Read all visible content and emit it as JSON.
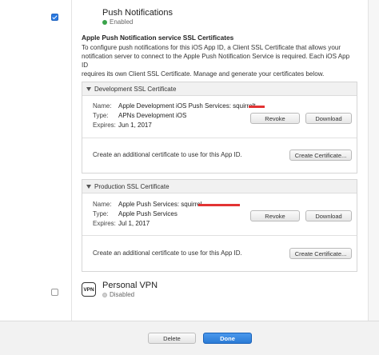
{
  "push": {
    "checked": true,
    "title": "Push Notifications",
    "status": "Enabled",
    "status_color": "#3aa34a",
    "description_title": "Apple Push Notification service SSL Certificates",
    "description_lines": [
      "To configure push notifications for this iOS App ID, a Client SSL Certificate that allows your",
      "notification server to connect to the Apple Push Notification Service is required. Each iOS App ID",
      "requires its own Client SSL Certificate. Manage and generate your certificates below."
    ]
  },
  "development": {
    "header": "Development SSL Certificate",
    "name_label": "Name:",
    "name_value": "Apple Development iOS Push Services: squirrelt",
    "type_label": "Type:",
    "type_value": "APNs Development iOS",
    "expires_label": "Expires:",
    "expires_value": "Jun 1, 2017",
    "revoke_label": "Revoke",
    "download_label": "Download",
    "create_text": "Create an additional certificate to use for this App ID.",
    "create_button": "Create Certificate..."
  },
  "production": {
    "header": "Production SSL Certificate",
    "name_label": "Name:",
    "name_value": "Apple Push Services: squirrel",
    "type_label": "Type:",
    "type_value": "Apple Push Services",
    "expires_label": "Expires:",
    "expires_value": "Jul 1, 2017",
    "revoke_label": "Revoke",
    "download_label": "Download",
    "create_text": "Create an additional certificate to use for this App ID.",
    "create_button": "Create Certificate..."
  },
  "vpn": {
    "checked": false,
    "icon_text": "VPN",
    "icon": "vpn-icon",
    "title": "Personal VPN",
    "status": "Disabled"
  },
  "footer": {
    "delete_label": "Delete",
    "done_label": "Done",
    "done_color": "#2b7bd6"
  },
  "colors": {
    "redaction": "#e23333"
  }
}
